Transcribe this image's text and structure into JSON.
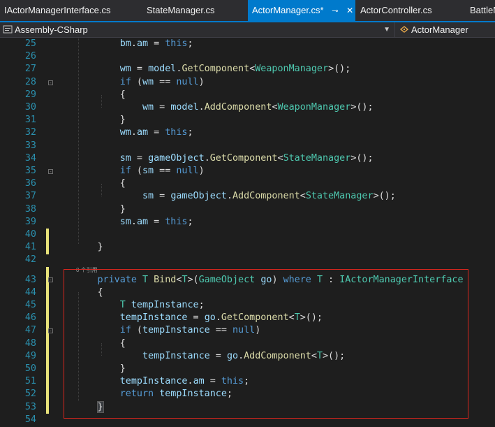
{
  "tabs": [
    {
      "label": "IActorManagerInterface.cs",
      "active": false
    },
    {
      "label": "StateManager.cs",
      "active": false
    },
    {
      "label": "ActorManager.cs*",
      "active": true
    },
    {
      "label": "ActorController.cs",
      "active": false
    },
    {
      "label": "BattleM",
      "active": false
    }
  ],
  "navbar": {
    "project": "Assembly-CSharp",
    "class": "ActorManager"
  },
  "codelens_hint": "0 个引用",
  "colors": {
    "keyword": "#569cd6",
    "type": "#4ec9b0",
    "method": "#dcdcaa",
    "variable": "#9cdcfe",
    "accent": "#007acc",
    "selection_box": "#d7261e",
    "line_number": "#2b91af"
  },
  "lines": [
    {
      "n": "25",
      "tokens": [
        [
          "            ",
          "p"
        ],
        [
          "bm",
          "v"
        ],
        [
          ".",
          "p"
        ],
        [
          "am",
          "v"
        ],
        [
          " = ",
          "p"
        ],
        [
          "this",
          "k"
        ],
        [
          ";",
          "p"
        ]
      ]
    },
    {
      "n": "26",
      "tokens": []
    },
    {
      "n": "27",
      "tokens": [
        [
          "            ",
          "p"
        ],
        [
          "wm",
          "v"
        ],
        [
          " = ",
          "p"
        ],
        [
          "model",
          "v"
        ],
        [
          ".",
          "p"
        ],
        [
          "GetComponent",
          "m"
        ],
        [
          "<",
          "p"
        ],
        [
          "WeaponManager",
          "t"
        ],
        [
          ">();",
          "p"
        ]
      ]
    },
    {
      "n": "28",
      "tokens": [
        [
          "            ",
          "p"
        ],
        [
          "if",
          "k"
        ],
        [
          " (",
          "p"
        ],
        [
          "wm",
          "v"
        ],
        [
          " == ",
          "p"
        ],
        [
          "null",
          "k"
        ],
        [
          ")",
          "p"
        ]
      ]
    },
    {
      "n": "29",
      "tokens": [
        [
          "            {",
          "p"
        ]
      ]
    },
    {
      "n": "30",
      "tokens": [
        [
          "                ",
          "p"
        ],
        [
          "wm",
          "v"
        ],
        [
          " = ",
          "p"
        ],
        [
          "model",
          "v"
        ],
        [
          ".",
          "p"
        ],
        [
          "AddComponent",
          "m"
        ],
        [
          "<",
          "p"
        ],
        [
          "WeaponManager",
          "t"
        ],
        [
          ">();",
          "p"
        ]
      ]
    },
    {
      "n": "31",
      "tokens": [
        [
          "            }",
          "p"
        ]
      ]
    },
    {
      "n": "32",
      "tokens": [
        [
          "            ",
          "p"
        ],
        [
          "wm",
          "v"
        ],
        [
          ".",
          "p"
        ],
        [
          "am",
          "v"
        ],
        [
          " = ",
          "p"
        ],
        [
          "this",
          "k"
        ],
        [
          ";",
          "p"
        ]
      ]
    },
    {
      "n": "33",
      "tokens": []
    },
    {
      "n": "34",
      "tokens": [
        [
          "            ",
          "p"
        ],
        [
          "sm",
          "v"
        ],
        [
          " = ",
          "p"
        ],
        [
          "gameObject",
          "v"
        ],
        [
          ".",
          "p"
        ],
        [
          "GetComponent",
          "m"
        ],
        [
          "<",
          "p"
        ],
        [
          "StateManager",
          "t"
        ],
        [
          ">();",
          "p"
        ]
      ]
    },
    {
      "n": "35",
      "tokens": [
        [
          "            ",
          "p"
        ],
        [
          "if",
          "k"
        ],
        [
          " (",
          "p"
        ],
        [
          "sm",
          "v"
        ],
        [
          " == ",
          "p"
        ],
        [
          "null",
          "k"
        ],
        [
          ")",
          "p"
        ]
      ]
    },
    {
      "n": "36",
      "tokens": [
        [
          "            {",
          "p"
        ]
      ]
    },
    {
      "n": "37",
      "tokens": [
        [
          "                ",
          "p"
        ],
        [
          "sm",
          "v"
        ],
        [
          " = ",
          "p"
        ],
        [
          "gameObject",
          "v"
        ],
        [
          ".",
          "p"
        ],
        [
          "AddComponent",
          "m"
        ],
        [
          "<",
          "p"
        ],
        [
          "StateManager",
          "t"
        ],
        [
          ">();",
          "p"
        ]
      ]
    },
    {
      "n": "38",
      "tokens": [
        [
          "            }",
          "p"
        ]
      ]
    },
    {
      "n": "39",
      "tokens": [
        [
          "            ",
          "p"
        ],
        [
          "sm",
          "v"
        ],
        [
          ".",
          "p"
        ],
        [
          "am",
          "v"
        ],
        [
          " = ",
          "p"
        ],
        [
          "this",
          "k"
        ],
        [
          ";",
          "p"
        ]
      ]
    },
    {
      "n": "40",
      "tokens": []
    },
    {
      "n": "41",
      "tokens": [
        [
          "        }",
          "p"
        ]
      ]
    },
    {
      "n": "42",
      "tokens": []
    },
    {
      "n": "43",
      "tokens": [
        [
          "        ",
          "p"
        ],
        [
          "private",
          "k"
        ],
        [
          " ",
          "p"
        ],
        [
          "T",
          "t"
        ],
        [
          " ",
          "p"
        ],
        [
          "Bind",
          "m"
        ],
        [
          "<",
          "p"
        ],
        [
          "T",
          "t"
        ],
        [
          ">(",
          "p"
        ],
        [
          "GameObject",
          "t"
        ],
        [
          " ",
          "p"
        ],
        [
          "go",
          "v"
        ],
        [
          ") ",
          "p"
        ],
        [
          "where",
          "k"
        ],
        [
          " ",
          "p"
        ],
        [
          "T",
          "t"
        ],
        [
          " : ",
          "p"
        ],
        [
          "IActorManagerInterface",
          "t"
        ]
      ]
    },
    {
      "n": "44",
      "tokens": [
        [
          "        {",
          "p"
        ]
      ]
    },
    {
      "n": "45",
      "tokens": [
        [
          "            ",
          "p"
        ],
        [
          "T",
          "t"
        ],
        [
          " ",
          "p"
        ],
        [
          "tempInstance",
          "v"
        ],
        [
          ";",
          "p"
        ]
      ]
    },
    {
      "n": "46",
      "tokens": [
        [
          "            ",
          "p"
        ],
        [
          "tempInstance",
          "v"
        ],
        [
          " = ",
          "p"
        ],
        [
          "go",
          "v"
        ],
        [
          ".",
          "p"
        ],
        [
          "GetComponent",
          "m"
        ],
        [
          "<",
          "p"
        ],
        [
          "T",
          "t"
        ],
        [
          ">();",
          "p"
        ]
      ]
    },
    {
      "n": "47",
      "tokens": [
        [
          "            ",
          "p"
        ],
        [
          "if",
          "k"
        ],
        [
          " (",
          "p"
        ],
        [
          "tempInstance",
          "v"
        ],
        [
          " == ",
          "p"
        ],
        [
          "null",
          "k"
        ],
        [
          ")",
          "p"
        ]
      ]
    },
    {
      "n": "48",
      "tokens": [
        [
          "            {",
          "p"
        ]
      ]
    },
    {
      "n": "49",
      "tokens": [
        [
          "                ",
          "p"
        ],
        [
          "tempInstance",
          "v"
        ],
        [
          " = ",
          "p"
        ],
        [
          "go",
          "v"
        ],
        [
          ".",
          "p"
        ],
        [
          "AddComponent",
          "m"
        ],
        [
          "<",
          "p"
        ],
        [
          "T",
          "t"
        ],
        [
          ">();",
          "p"
        ]
      ]
    },
    {
      "n": "50",
      "tokens": [
        [
          "            }",
          "p"
        ]
      ]
    },
    {
      "n": "51",
      "tokens": [
        [
          "            ",
          "p"
        ],
        [
          "tempInstance",
          "v"
        ],
        [
          ".",
          "p"
        ],
        [
          "am",
          "v"
        ],
        [
          " = ",
          "p"
        ],
        [
          "this",
          "k"
        ],
        [
          ";",
          "p"
        ]
      ]
    },
    {
      "n": "52",
      "tokens": [
        [
          "            ",
          "p"
        ],
        [
          "return",
          "k"
        ],
        [
          " ",
          "p"
        ],
        [
          "tempInstance",
          "v"
        ],
        [
          ";",
          "p"
        ]
      ]
    },
    {
      "n": "53",
      "tokens": [
        [
          "        ",
          "p"
        ],
        [
          "}",
          "p"
        ]
      ]
    },
    {
      "n": "54",
      "tokens": []
    }
  ]
}
